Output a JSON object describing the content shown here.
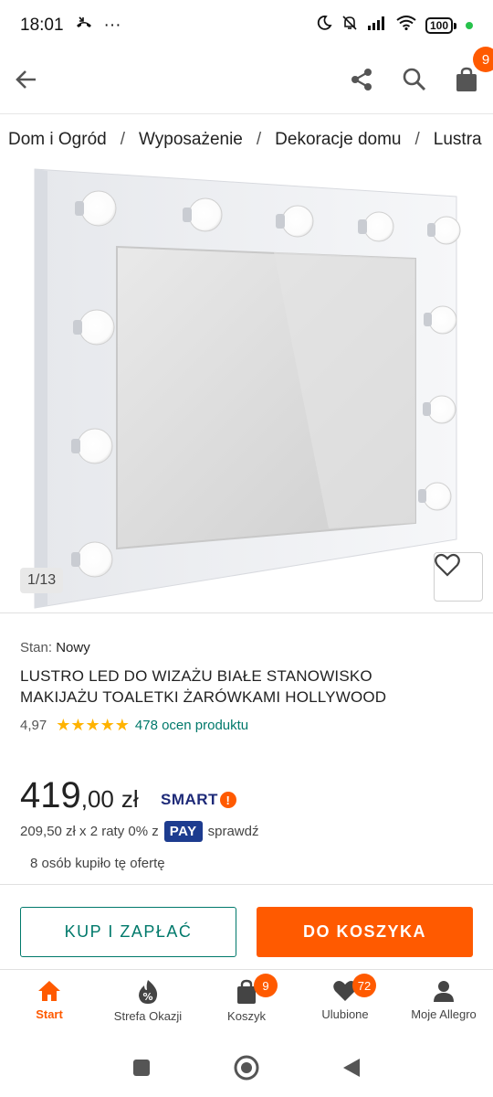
{
  "status_bar": {
    "time": "18:01",
    "more": "···",
    "battery": "100"
  },
  "app_bar": {
    "cart_count": "9"
  },
  "breadcrumb": [
    "Dom i Ogród",
    "Wyposażenie",
    "Dekoracje domu",
    "Lustra"
  ],
  "breadcrumb_separator": "/",
  "gallery": {
    "counter": "1/13"
  },
  "product": {
    "condition_label": "Stan:",
    "condition_value": "Nowy",
    "title_line1": "LUSTRO LED DO WIZAŻU BIAŁE STANOWISKO",
    "title_line2": "MAKIJAŻU TOALETKI ŻARÓWKAMI HOLLYWOOD",
    "rating": "4,97",
    "stars": "★★★★★",
    "rating_value": 5,
    "reviews": "478 ocen produktu"
  },
  "price": {
    "integer": "419",
    "decimal": ",00",
    "currency": "zł",
    "smart": "SMART",
    "smart_mark": "!"
  },
  "installments": {
    "text": "209,50 zł x 2 raty 0% z",
    "pay": "PAY",
    "link": "sprawdź"
  },
  "bought": "8 osób kupiło tę ofertę",
  "buttons": {
    "buy": "KUP I ZAPŁAĆ",
    "cart": "DO KOSZYKA"
  },
  "bottom_nav": [
    {
      "label": "Start",
      "icon": "home-icon"
    },
    {
      "label": "Strefa Okazji",
      "icon": "discount-icon"
    },
    {
      "label": "Koszyk",
      "icon": "bag-icon",
      "badge": "9"
    },
    {
      "label": "Ulubione",
      "icon": "heart-icon",
      "badge": "72"
    },
    {
      "label": "Moje Allegro",
      "icon": "person-icon"
    }
  ],
  "colors": {
    "accent": "#ff5a00",
    "teal": "#00796b",
    "smart_blue": "#1e2a78",
    "pay_blue": "#1d3c8f",
    "stars": "#ffb300"
  }
}
